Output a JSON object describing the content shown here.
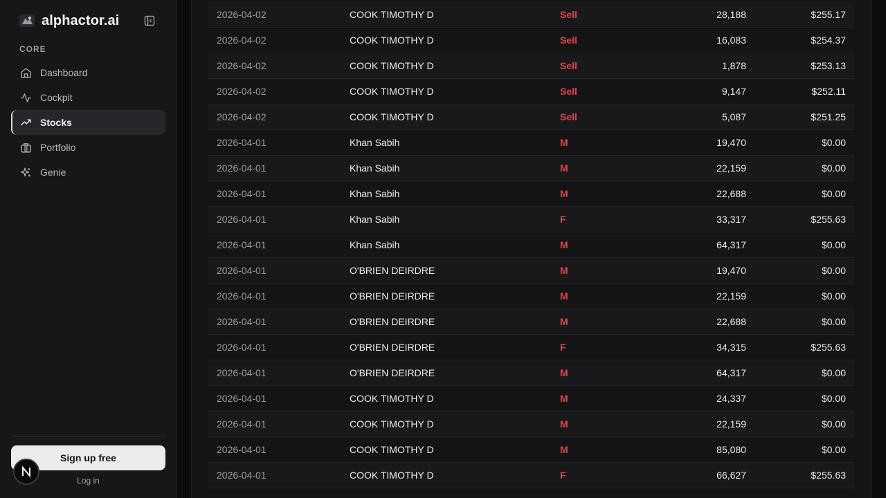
{
  "brand": {
    "name": "alphactor.ai"
  },
  "sidebar": {
    "section_label": "CORE",
    "items": [
      {
        "label": "Dashboard",
        "icon": "home-icon"
      },
      {
        "label": "Cockpit",
        "icon": "activity-icon"
      },
      {
        "label": "Stocks",
        "icon": "trending-up-icon",
        "active": true
      },
      {
        "label": "Portfolio",
        "icon": "briefcase-icon"
      },
      {
        "label": "Genie",
        "icon": "sparkles-icon"
      }
    ],
    "signup_label": "Sign up free",
    "login_label": "Log in",
    "badge_letter": "N"
  },
  "colors": {
    "sell": "#e0444a",
    "background": "#0c0c0e",
    "sidebar": "#17171a"
  },
  "transactions": [
    {
      "date": "2026-04-02",
      "name": "COOK TIMOTHY D",
      "type": "Sell",
      "shares": "28,188",
      "price": "$255.17"
    },
    {
      "date": "2026-04-02",
      "name": "COOK TIMOTHY D",
      "type": "Sell",
      "shares": "16,083",
      "price": "$254.37"
    },
    {
      "date": "2026-04-02",
      "name": "COOK TIMOTHY D",
      "type": "Sell",
      "shares": "1,878",
      "price": "$253.13"
    },
    {
      "date": "2026-04-02",
      "name": "COOK TIMOTHY D",
      "type": "Sell",
      "shares": "9,147",
      "price": "$252.11"
    },
    {
      "date": "2026-04-02",
      "name": "COOK TIMOTHY D",
      "type": "Sell",
      "shares": "5,087",
      "price": "$251.25"
    },
    {
      "date": "2026-04-01",
      "name": "Khan Sabih",
      "type": "M",
      "shares": "19,470",
      "price": "$0.00"
    },
    {
      "date": "2026-04-01",
      "name": "Khan Sabih",
      "type": "M",
      "shares": "22,159",
      "price": "$0.00"
    },
    {
      "date": "2026-04-01",
      "name": "Khan Sabih",
      "type": "M",
      "shares": "22,688",
      "price": "$0.00"
    },
    {
      "date": "2026-04-01",
      "name": "Khan Sabih",
      "type": "F",
      "shares": "33,317",
      "price": "$255.63"
    },
    {
      "date": "2026-04-01",
      "name": "Khan Sabih",
      "type": "M",
      "shares": "64,317",
      "price": "$0.00"
    },
    {
      "date": "2026-04-01",
      "name": "O'BRIEN DEIRDRE",
      "type": "M",
      "shares": "19,470",
      "price": "$0.00"
    },
    {
      "date": "2026-04-01",
      "name": "O'BRIEN DEIRDRE",
      "type": "M",
      "shares": "22,159",
      "price": "$0.00"
    },
    {
      "date": "2026-04-01",
      "name": "O'BRIEN DEIRDRE",
      "type": "M",
      "shares": "22,688",
      "price": "$0.00"
    },
    {
      "date": "2026-04-01",
      "name": "O'BRIEN DEIRDRE",
      "type": "F",
      "shares": "34,315",
      "price": "$255.63"
    },
    {
      "date": "2026-04-01",
      "name": "O'BRIEN DEIRDRE",
      "type": "M",
      "shares": "64,317",
      "price": "$0.00"
    },
    {
      "date": "2026-04-01",
      "name": "COOK TIMOTHY D",
      "type": "M",
      "shares": "24,337",
      "price": "$0.00"
    },
    {
      "date": "2026-04-01",
      "name": "COOK TIMOTHY D",
      "type": "M",
      "shares": "22,159",
      "price": "$0.00"
    },
    {
      "date": "2026-04-01",
      "name": "COOK TIMOTHY D",
      "type": "M",
      "shares": "85,080",
      "price": "$0.00"
    },
    {
      "date": "2026-04-01",
      "name": "COOK TIMOTHY D",
      "type": "F",
      "shares": "66,627",
      "price": "$255.63"
    }
  ]
}
